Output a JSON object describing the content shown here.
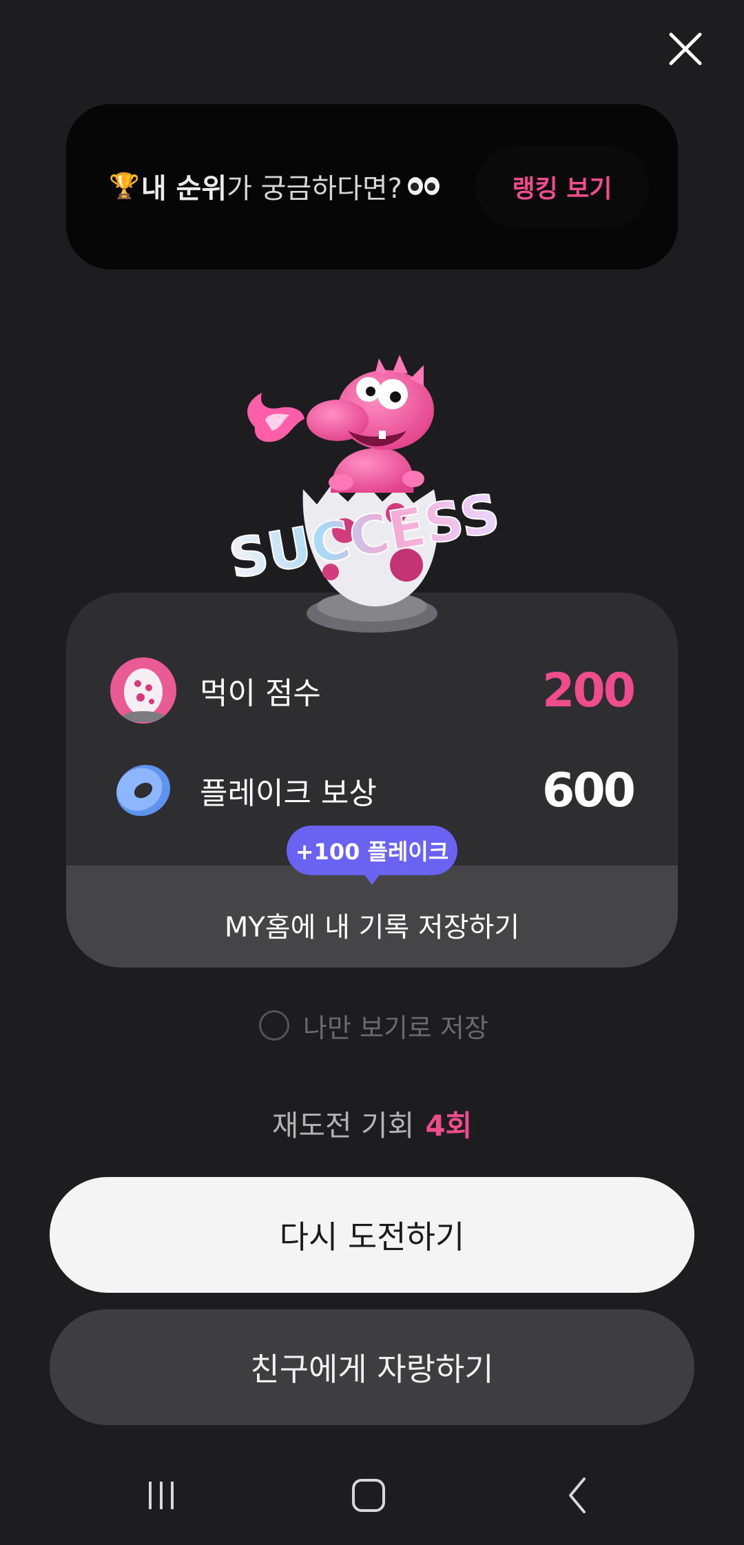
{
  "header": {
    "close_icon": "close-icon"
  },
  "banner": {
    "trophy": "🏆",
    "bold_text": "내 순위",
    "text": "가 궁금하다면?",
    "rank_button_label": "랭킹 보기"
  },
  "mascot": {
    "badge_text": "SUCCESS"
  },
  "results": {
    "score_label": "먹이 점수",
    "score_value": "200",
    "reward_label": "플레이크 보상",
    "reward_value": "600",
    "bonus_bubble": "+100 플레이크",
    "save_label": "MY홈에 내 기록 저장하기"
  },
  "private_option": {
    "label": "나만 보기로 저장",
    "checked": false
  },
  "retry": {
    "label": "재도전 기회",
    "count": "4회"
  },
  "buttons": {
    "retry_label": "다시 도전하기",
    "share_label": "친구에게 자랑하기"
  },
  "navbar": {
    "items": [
      "recent-apps-icon",
      "home-icon",
      "back-icon"
    ]
  },
  "colors": {
    "background": "#1d1d1f",
    "accent_pink": "#ef4c8d",
    "bubble_purple": "#6a62f0",
    "card": "#2e2e30"
  }
}
